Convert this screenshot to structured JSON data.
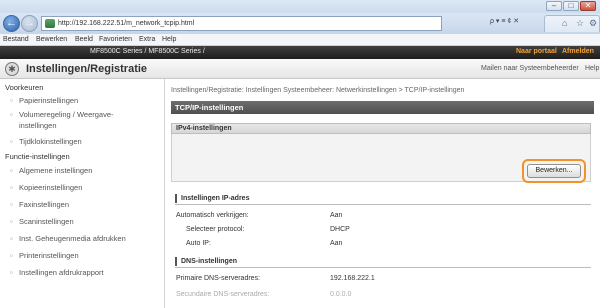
{
  "browser": {
    "url": "http://192.168.222.51/m_network_tcpip.html",
    "search_placeholder": "",
    "tools_glyphs": "ρ ▾ ≡ ¢ ✕",
    "menu": [
      "Bestand",
      "Bewerken",
      "Beeld",
      "Favorieten",
      "Extra",
      "Help"
    ]
  },
  "app": {
    "device_label": "MF8500C Series / MF8500C Series /",
    "portal_link": "Naar portaal",
    "logout_link": "Afmelden",
    "page_title": "Instellingen/Registratie",
    "sysadmin_link": "Mailen naar Systeembeheerder",
    "help_link": "Help"
  },
  "sidebar": {
    "prefs_heading": "Voorkeuren",
    "prefs_items": [
      "Papierinstellingen",
      "Volumeregeling / Weergave-instellingen",
      "Tijdklokinstellingen"
    ],
    "functions_heading": "Functie-instellingen",
    "function_items": [
      "Algemene instellingen",
      "Kopieerinstellingen",
      "Faxinstellingen",
      "Scaninstellingen",
      "Inst. Geheugenmedia afdrukken",
      "Printerinstellingen",
      "Instellingen afdrukrapport"
    ]
  },
  "main": {
    "breadcrumb": "Instellingen/Registratie: Instellingen Systeembeheer: Netwerkinstellingen > TCP/IP-instellingen",
    "section_title": "TCP/IP-instellingen",
    "ipv4_header": "IPv4-instellingen",
    "edit_button": "Bewerken...",
    "ip_section": {
      "title": "Instellingen IP-adres",
      "rows": [
        {
          "label": "Automatisch verkrijgen:",
          "value": "Aan"
        },
        {
          "label": "Selecteer protocol:",
          "value": "DHCP"
        },
        {
          "label": "Auto IP:",
          "value": "Aan"
        }
      ]
    },
    "dns_section": {
      "title": "DNS-instellingen",
      "rows": [
        {
          "label": "Primaire DNS-serveradres:",
          "value": "192.168.222.1"
        },
        {
          "label": "Secundaire DNS-serveradres:",
          "value": "0.0.0.0"
        }
      ]
    }
  },
  "colors": {
    "accent_link": "#f1a33a",
    "callout": "#f0932b",
    "section_bar": "#5c5c5c"
  }
}
